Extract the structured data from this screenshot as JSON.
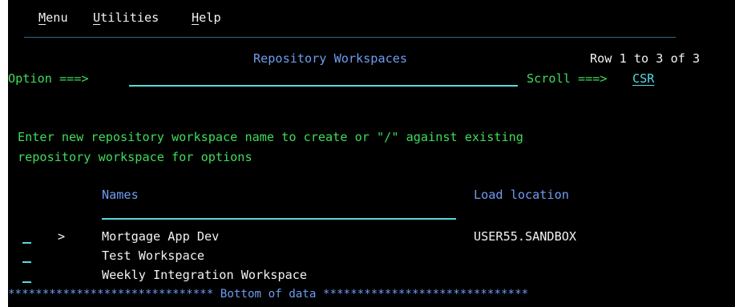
{
  "menubar": {
    "items": [
      {
        "mnemonic": "M",
        "rest": "enu"
      },
      {
        "mnemonic": "U",
        "rest": "tilities"
      },
      {
        "mnemonic": "H",
        "rest": "elp"
      }
    ]
  },
  "header": {
    "title": "Repository Workspaces",
    "row_info": "Row 1 to 3 of 3",
    "option_label": "Option ===>",
    "option_value": "",
    "scroll_label": "Scroll ===>",
    "scroll_value": "CSR"
  },
  "instructions": {
    "line1": "Enter new repository workspace name to create or \"/\" against existing",
    "line2": "repository workspace for options"
  },
  "table": {
    "columns": {
      "name": "Names",
      "location": "Load location"
    },
    "rows": [
      {
        "cursor": ">",
        "name": "Mortgage App Dev",
        "location": "USER55.SANDBOX"
      },
      {
        "cursor": "",
        "name": "Test Workspace",
        "location": ""
      },
      {
        "cursor": "",
        "name": "Weekly Integration Workspace",
        "location": ""
      }
    ],
    "footer": "****************************** Bottom of data ******************************"
  },
  "colors": {
    "background": "#000000",
    "text_white": "#f2f2f2",
    "text_blue": "#6f9cf0",
    "text_green": "#3fdc5a",
    "text_turquoise": "#5ad8df"
  }
}
